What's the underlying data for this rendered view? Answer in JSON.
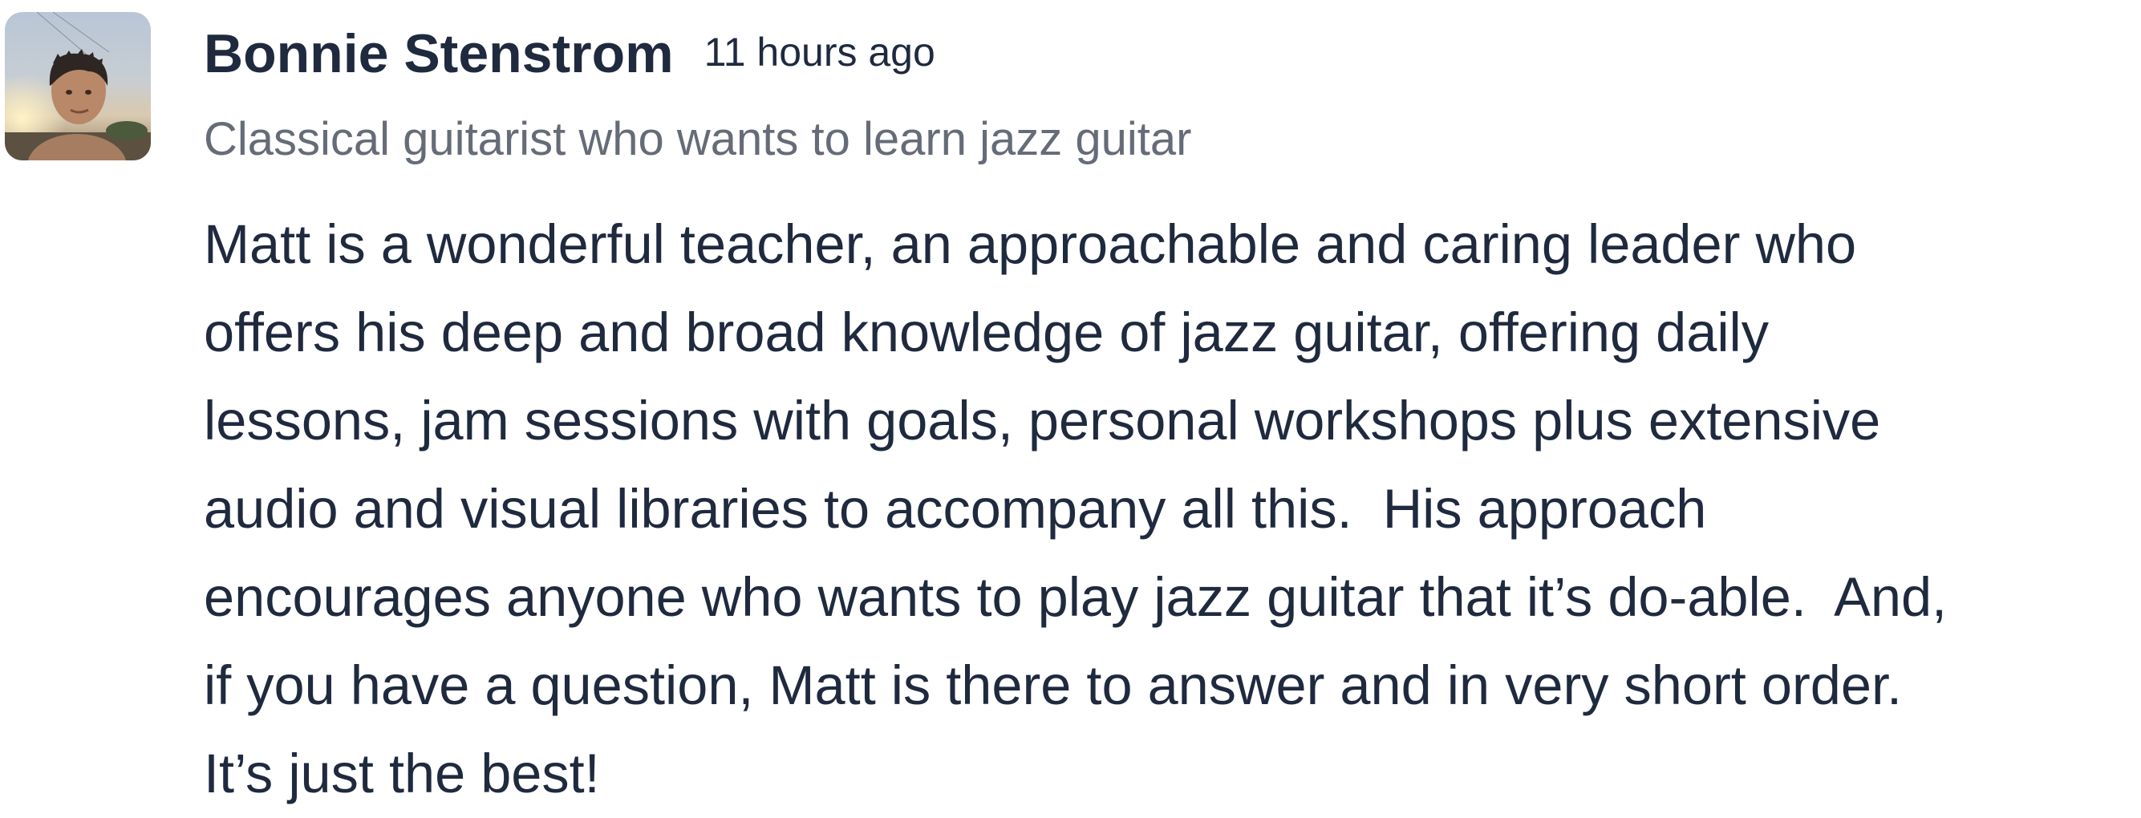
{
  "review": {
    "author_name": "Bonnie Stenstrom",
    "timestamp": "11 hours ago",
    "tagline": "Classical guitarist who wants to learn jazz guitar",
    "body_lines": [
      "Matt is a wonderful teacher, an approachable and caring leader who",
      "offers his deep and broad knowledge of jazz guitar, offering daily",
      "lessons, jam sessions with goals, personal workshops plus extensive",
      "audio and visual libraries to accompany all this.  His approach",
      "encourages anyone who wants to play jazz guitar that it’s do-able.  And,",
      "if you have a question, Matt is there to answer and in very short order.",
      "It’s just the best!"
    ]
  },
  "colors": {
    "text_primary": "#1f2a3f",
    "text_secondary": "#666c77",
    "background": "#ffffff"
  }
}
